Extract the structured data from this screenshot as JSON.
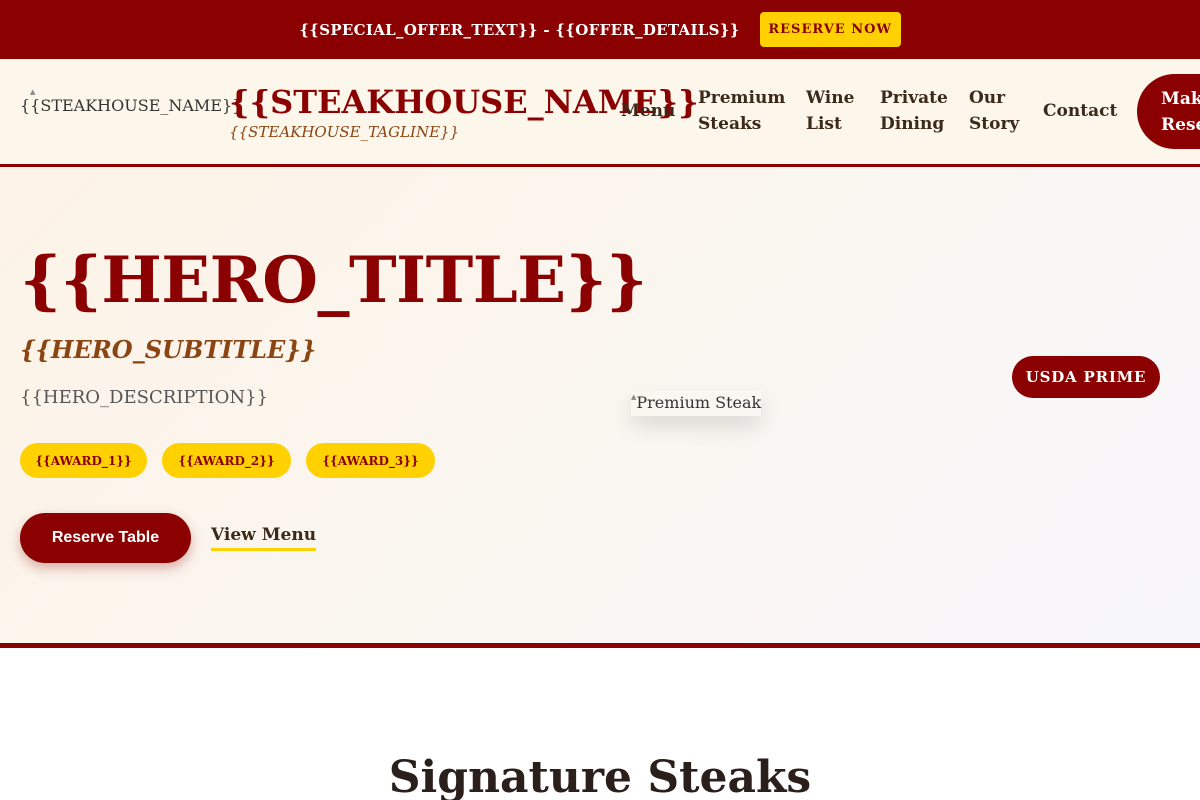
{
  "offer_bar": {
    "text": "{{SPECIAL_OFFER_TEXT}} - {{OFFER_DETAILS}}",
    "button_label": "Reserve Now"
  },
  "header": {
    "logo_alt": "{{STEAKHOUSE_NAME}}",
    "name": "{{STEAKHOUSE_NAME}}",
    "tagline": "{{STEAKHOUSE_TAGLINE}}",
    "nav": {
      "menu": "Menu",
      "premium_1": "Premium",
      "premium_2": "Steaks",
      "wine_1": "Wine",
      "wine_2": "List",
      "private_1": "Private",
      "private_2": "Dining",
      "story_1": "Our",
      "story_2": "Story",
      "contact": "Contact"
    },
    "cta_line1": "Make",
    "cta_line2": "Reservation"
  },
  "hero": {
    "title": "{{HERO_TITLE}}",
    "subtitle": "{{HERO_SUBTITLE}}",
    "description": "{{HERO_DESCRIPTION}}",
    "awards": [
      "{{AWARD_1}}",
      "{{AWARD_2}}",
      "{{AWARD_3}}"
    ],
    "reserve_button": "Reserve Table",
    "menu_link": "View Menu",
    "image_alt": "Premium Steak",
    "badge": "USDA Prime"
  },
  "signature": {
    "title": "Signature Steaks"
  },
  "colors": {
    "brand_red": "#8b0000",
    "accent_gold": "#ffd100",
    "accent_brown": "#8b4513"
  },
  "icons": {
    "broken_image": "broken-image-icon"
  }
}
